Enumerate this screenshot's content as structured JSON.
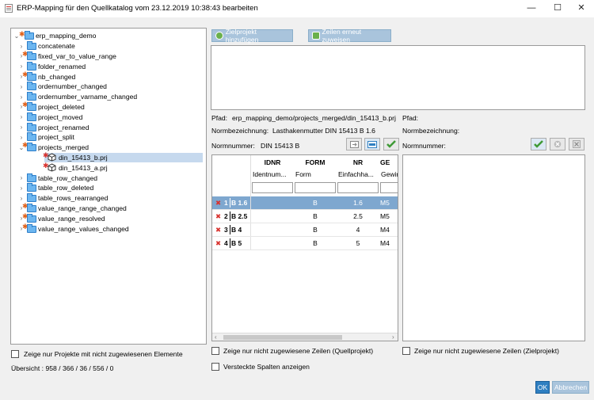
{
  "window": {
    "title": "ERP-Mapping für den Quellkatalog vom 23.12.2019 10:38:43 bearbeiten",
    "minimize": "—",
    "maximize": "☐",
    "close": "✕"
  },
  "tree": {
    "root": "erp_mapping_demo",
    "items": [
      {
        "label": "concatenate",
        "changed": false
      },
      {
        "label": "fixed_var_to_value_range",
        "changed": true
      },
      {
        "label": "folder_renamed",
        "changed": false
      },
      {
        "label": "nb_changed",
        "changed": true
      },
      {
        "label": "ordernumber_changed",
        "changed": false
      },
      {
        "label": "ordernumber_varname_changed",
        "changed": false
      },
      {
        "label": "project_deleted",
        "changed": true
      },
      {
        "label": "project_moved",
        "changed": false
      },
      {
        "label": "project_renamed",
        "changed": false
      },
      {
        "label": "project_split",
        "changed": false
      },
      {
        "label": "projects_merged",
        "changed": true
      },
      {
        "label": "din_15413_b.prj",
        "changed": true
      },
      {
        "label": "din_15413_a.prj",
        "changed": true
      },
      {
        "label": "table_row_changed",
        "changed": false
      },
      {
        "label": "table_row_deleted",
        "changed": false
      },
      {
        "label": "table_rows_rearranged",
        "changed": false
      },
      {
        "label": "value_range_range_changed",
        "changed": true
      },
      {
        "label": "value_range_resolved",
        "changed": true
      },
      {
        "label": "value_range_values_changed",
        "changed": true
      }
    ]
  },
  "left": {
    "checkbox_label": "Zeige nur Projekte mit nicht zugewiesenen Elemente",
    "summary": "Übersicht : 958 / 366 / 36 / 556 / 0"
  },
  "toolbar": {
    "add_target": "Zielprojekt hinzufügen",
    "reassign": "Zeilen erneut zuweisen"
  },
  "source": {
    "pfad_label": "Pfad:",
    "pfad_value": "erp_mapping_demo/projects_merged/din_15413_b.prj",
    "normbez_label": "Normbezeichnung:",
    "normbez_value": "Lasthakenmutter DIN 15413 B 1.6",
    "normnr_label": "Normnummer:",
    "normnr_value": "DIN 15413 B"
  },
  "target": {
    "pfad_label": "Pfad:",
    "normbez_label": "Normbezeichnung:",
    "normnr_label": "Normnummer:"
  },
  "table": {
    "columns": [
      {
        "name": "IDNR",
        "sub": "Identnum..."
      },
      {
        "name": "FORM",
        "sub": "Form"
      },
      {
        "name": "NR",
        "sub": "Einfachha..."
      },
      {
        "name": "GE",
        "sub": "Gewind"
      }
    ],
    "rows": [
      {
        "num": "1",
        "key": "B 1.6",
        "form": "B",
        "nr": "1.6",
        "ge": "M5"
      },
      {
        "num": "2",
        "key": "B 2.5",
        "form": "B",
        "nr": "2.5",
        "ge": "M5"
      },
      {
        "num": "3",
        "key": "B 4",
        "form": "B",
        "nr": "4",
        "ge": "M4"
      },
      {
        "num": "4",
        "key": "B 5",
        "form": "B",
        "nr": "5",
        "ge": "M4"
      }
    ]
  },
  "options": {
    "only_unassigned_source": "Zeige nur nicht zugewiesene Zeilen (Quellprojekt)",
    "show_hidden_columns": "Versteckte Spalten anzeigen",
    "only_unassigned_target": "Zeige nur nicht zugewiesene Zeilen (Zielprojekt)"
  },
  "footer": {
    "ok": "OK",
    "cancel": "Abbrechen"
  },
  "colors": {
    "accent": "#2f7fc1",
    "disabled_button": "#a9c4dc",
    "selected_row": "#7ea7cf",
    "error_x": "#d9332f"
  }
}
